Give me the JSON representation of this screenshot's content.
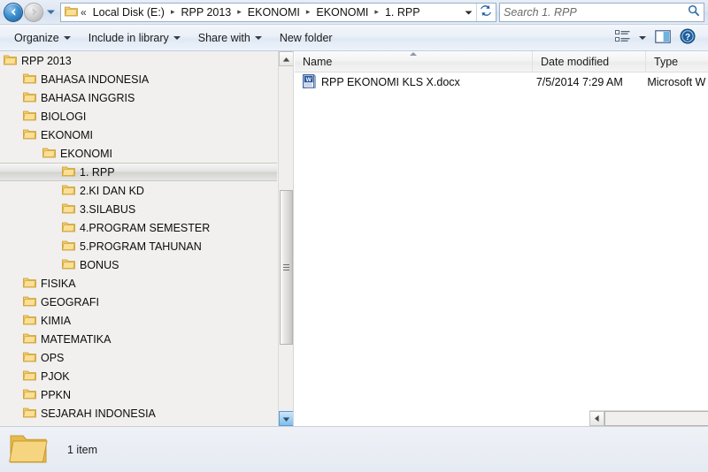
{
  "addressbar": {
    "back_icon": "back-arrow-icon",
    "forward_icon": "forward-arrow-icon",
    "history_icon": "history-dropdown-icon",
    "chevrons": "«",
    "breadcrumbs": [
      "Local Disk (E:)",
      "RPP 2013",
      "EKONOMI",
      "EKONOMI",
      "1. RPP"
    ],
    "separator": "▸",
    "dropdown_icon": "chevron-down-icon",
    "refresh_icon": "refresh-icon",
    "search_placeholder": "Search 1. RPP",
    "search_value": "",
    "search_icon": "search-icon"
  },
  "toolbar": {
    "organize_label": "Organize",
    "include_label": "Include in library",
    "share_label": "Share with",
    "newfolder_label": "New folder",
    "views_icon": "view-options-icon",
    "views_caret_icon": "chevron-down-icon",
    "preview_icon": "preview-pane-icon",
    "help_icon": "help-icon"
  },
  "tree": {
    "items": [
      {
        "label": "RPP 2013",
        "indent": 0,
        "selected": false
      },
      {
        "label": "BAHASA INDONESIA",
        "indent": 1,
        "selected": false
      },
      {
        "label": "BAHASA INGGRIS",
        "indent": 1,
        "selected": false
      },
      {
        "label": "BIOLOGI",
        "indent": 1,
        "selected": false
      },
      {
        "label": "EKONOMI",
        "indent": 1,
        "selected": false
      },
      {
        "label": "EKONOMI",
        "indent": 2,
        "selected": false
      },
      {
        "label": "1. RPP",
        "indent": 3,
        "selected": true
      },
      {
        "label": "2.KI DAN KD",
        "indent": 3,
        "selected": false
      },
      {
        "label": "3.SILABUS",
        "indent": 3,
        "selected": false
      },
      {
        "label": "4.PROGRAM SEMESTER",
        "indent": 3,
        "selected": false
      },
      {
        "label": "5.PROGRAM TAHUNAN",
        "indent": 3,
        "selected": false
      },
      {
        "label": "BONUS",
        "indent": 3,
        "selected": false
      },
      {
        "label": "FISIKA",
        "indent": 1,
        "selected": false
      },
      {
        "label": "GEOGRAFI",
        "indent": 1,
        "selected": false
      },
      {
        "label": "KIMIA",
        "indent": 1,
        "selected": false
      },
      {
        "label": "MATEMATIKA",
        "indent": 1,
        "selected": false
      },
      {
        "label": "OPS",
        "indent": 1,
        "selected": false
      },
      {
        "label": "PJOK",
        "indent": 1,
        "selected": false
      },
      {
        "label": "PPKN",
        "indent": 1,
        "selected": false
      },
      {
        "label": "SEJARAH INDONESIA",
        "indent": 1,
        "selected": false
      }
    ],
    "scroll_up_icon": "scroll-up-arrow-icon",
    "scroll_down_icon": "scroll-down-arrow-icon"
  },
  "filelist": {
    "columns": [
      {
        "label": "Name",
        "sorted": "asc"
      },
      {
        "label": "Date modified",
        "sorted": ""
      },
      {
        "label": "Type",
        "sorted": ""
      }
    ],
    "rows": [
      {
        "name": "RPP EKONOMI KLS X.docx",
        "date_modified": "7/5/2014 7:29 AM",
        "type": "Microsoft W",
        "icon": "word-document-icon"
      }
    ],
    "scroll_left_icon": "scroll-left-arrow-icon",
    "scroll_right_icon": "scroll-right-arrow-icon"
  },
  "statusbar": {
    "folder_icon": "folder-icon",
    "item_count_text": "1 item"
  },
  "colors": {
    "folder_fill": "#f5cc6a",
    "folder_edge": "#c99b2e",
    "accent_blue": "#2f7fc4",
    "selection_gray": "#d8d8d5"
  }
}
